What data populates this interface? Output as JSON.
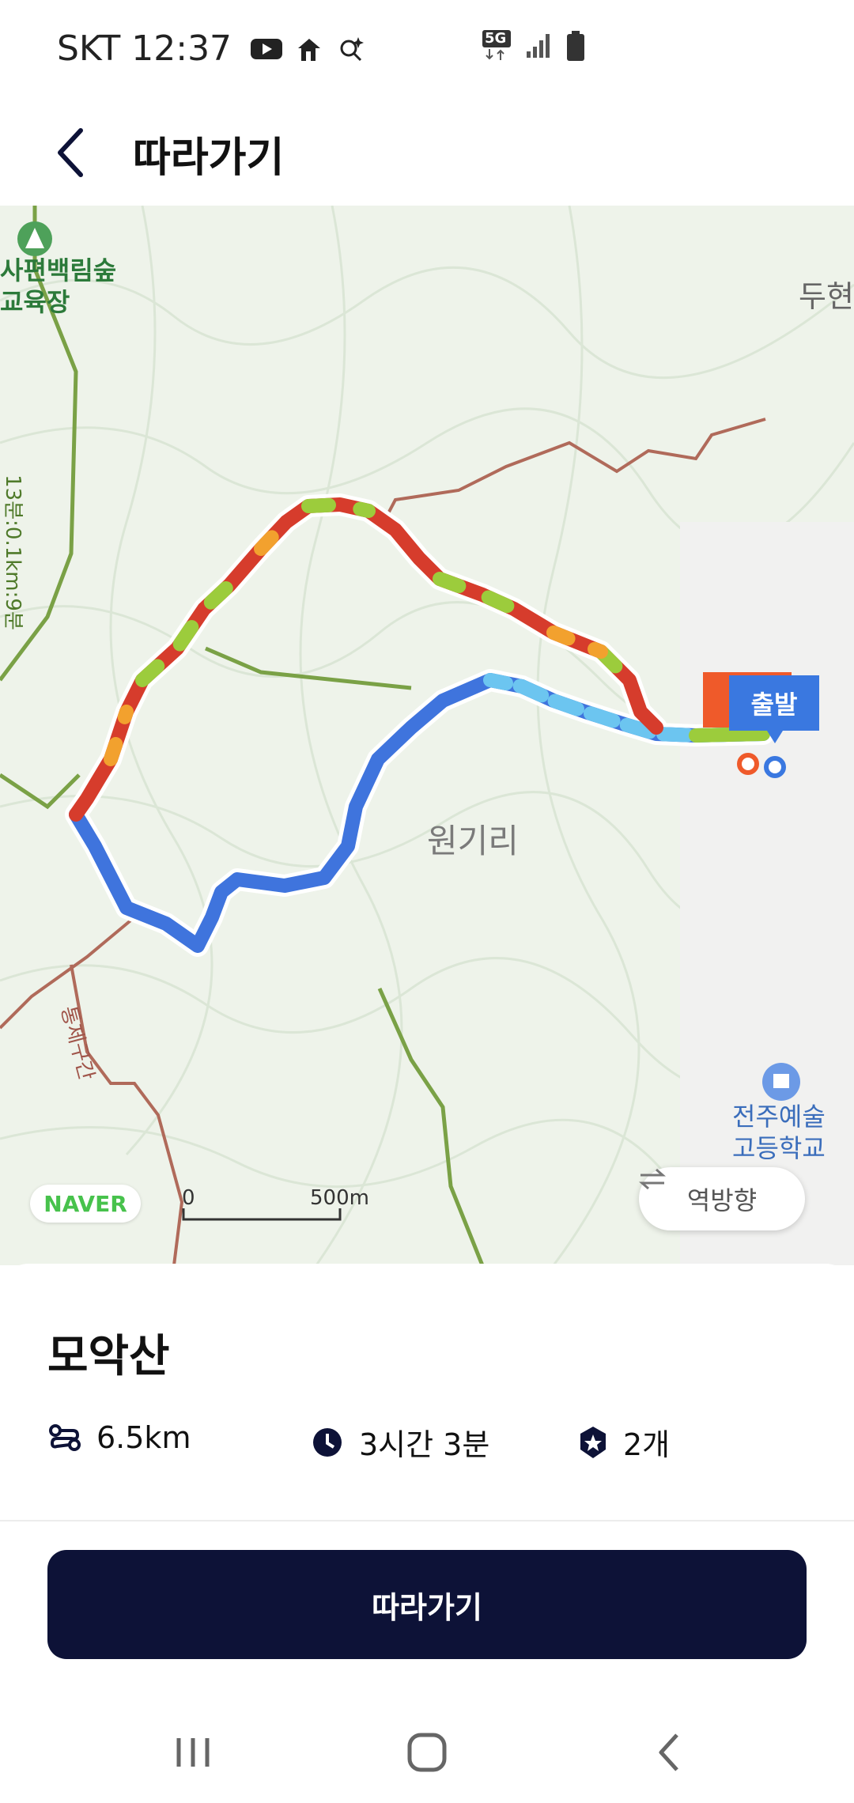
{
  "status_bar": {
    "carrier": "SKT",
    "time": "12:37",
    "network": "5G"
  },
  "header": {
    "title": "따라가기"
  },
  "map": {
    "poi": "사편백림숲\n교육장",
    "village": "원기리",
    "top_right": "두현",
    "school": "전주예술\n고등학교",
    "trail_note": "13분:0.1km:9분",
    "side_label": "통제구간",
    "naver": "NAVER",
    "scale_zero": "0",
    "scale_distance": "500m",
    "reverse_label": "역방향",
    "start_label": "출발"
  },
  "trail": {
    "name": "모악산",
    "distance": "6.5km",
    "duration": "3시간 3분",
    "badges": "2개"
  },
  "action": {
    "follow_label": "따라가기"
  },
  "colors": {
    "primary": "#0d1237",
    "start_marker": "#3a78e0",
    "end_marker": "#ef5a2a"
  }
}
